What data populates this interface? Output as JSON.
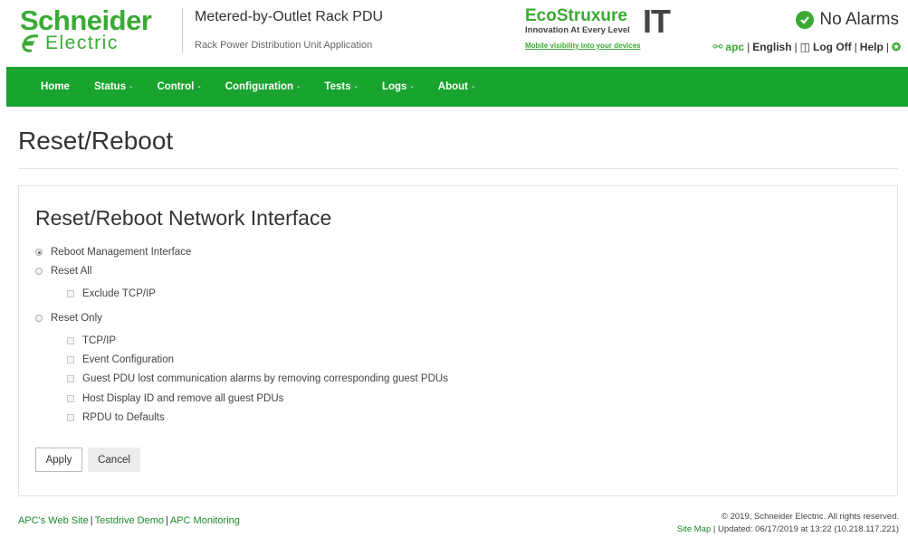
{
  "header": {
    "brand_top": "Schneider",
    "brand_bottom": "Electric",
    "product_title": "Metered-by-Outlet Rack PDU",
    "product_subtitle": "Rack Power Distribution Unit Application",
    "eco_name": "EcoStruxure",
    "eco_it": "IT",
    "eco_tagline": "Innovation At Every Level",
    "eco_mobile": "Mobile visibility into your devices",
    "alarm_status": "No Alarms",
    "user": "apc",
    "language": "English",
    "logoff": "Log Off",
    "help": "Help"
  },
  "nav": {
    "items": [
      {
        "label": "Home",
        "dropdown": false
      },
      {
        "label": "Status",
        "dropdown": true
      },
      {
        "label": "Control",
        "dropdown": true
      },
      {
        "label": "Configuration",
        "dropdown": true
      },
      {
        "label": "Tests",
        "dropdown": true
      },
      {
        "label": "Logs",
        "dropdown": true
      },
      {
        "label": "About",
        "dropdown": true
      }
    ],
    "caret": "-"
  },
  "page": {
    "title": "Reset/Reboot",
    "panel_title": "Reset/Reboot Network Interface",
    "options": {
      "reboot_mgmt": {
        "label": "Reboot Management Interface",
        "checked": true
      },
      "reset_all": {
        "label": "Reset All",
        "checked": false
      },
      "exclude_tcpip": {
        "label": "Exclude TCP/IP",
        "checked": false
      },
      "reset_only": {
        "label": "Reset Only",
        "checked": false
      },
      "tcpip": {
        "label": "TCP/IP",
        "checked": false
      },
      "event_config": {
        "label": "Event Configuration",
        "checked": false
      },
      "guest_pdu_alarms": {
        "label": "Guest PDU lost communication alarms by removing corresponding guest PDUs",
        "checked": false
      },
      "host_display_id": {
        "label": "Host Display ID and remove all guest PDUs",
        "checked": false
      },
      "rpdu_defaults": {
        "label": "RPDU to Defaults",
        "checked": false
      }
    },
    "apply_label": "Apply",
    "cancel_label": "Cancel"
  },
  "footer": {
    "link_web": "APC's Web Site",
    "link_testdrive": "Testdrive Demo",
    "link_monitoring": "APC Monitoring",
    "copyright": "© 2019, Schneider Electric. All rights reserved.",
    "sitemap": "Site Map",
    "updated": "Updated: 06/17/2019 at 13:22 (10.218.117.221)"
  },
  "colors": {
    "brand_green": "#3aaa35",
    "nav_green": "#19a32f",
    "link_green": "#1a8a2e"
  }
}
